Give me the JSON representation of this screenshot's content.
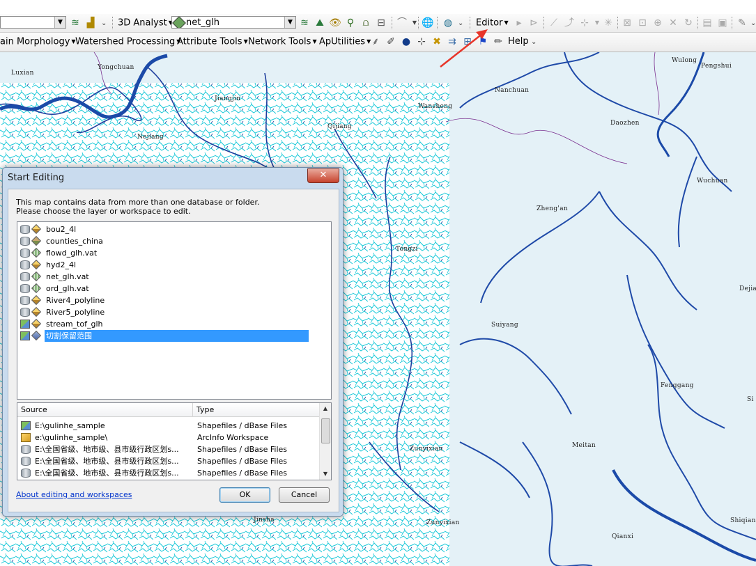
{
  "toolbar1": {
    "analyst_label": "3D Analyst",
    "layer_combo_value": "net_glh",
    "editor_label": "Editor"
  },
  "toolbar2": {
    "menus": [
      "ain Morphology",
      "Watershed Processing",
      "Attribute Tools",
      "Network Tools",
      "ApUtilities"
    ],
    "help_label": "Help"
  },
  "map": {
    "places": [
      "Luxian",
      "Yongchuan",
      "Jiangjin",
      "Nejiang",
      "Qijiang",
      "Wansheng",
      "Nanchuan",
      "Daozhen",
      "Wulong",
      "Pengshui",
      "Wuchuan",
      "Zheng'an",
      "Tongzi",
      "Dejia",
      "Suiyang",
      "Fenggang",
      "Si",
      "Zunyixian",
      "Meitan",
      "Jinsha",
      "Zunyixian",
      "Qianxi",
      "Shiqian"
    ]
  },
  "dialog": {
    "title": "Start Editing",
    "close_glyph": "✕",
    "message_line1": "This map contains data from more than one database or folder.",
    "message_line2": "Please choose the layer or workspace to edit.",
    "layers": [
      {
        "name": "bou2_4l"
      },
      {
        "name": "counties_china"
      },
      {
        "name": "flowd_glh.vat"
      },
      {
        "name": "hyd2_4l"
      },
      {
        "name": "net_glh.vat"
      },
      {
        "name": "ord_glh.vat"
      },
      {
        "name": "River4_polyline"
      },
      {
        "name": "River5_polyline"
      },
      {
        "name": "stream_tof_glh"
      },
      {
        "name": "切割保留范围",
        "selected": true
      }
    ],
    "table_headers": {
      "source": "Source",
      "type": "Type"
    },
    "sources": [
      {
        "source": "E:\\gulinhe_sample",
        "type": "Shapefiles / dBase Files"
      },
      {
        "source": "e:\\gulinhe_sample\\",
        "type": "ArcInfo Workspace"
      },
      {
        "source": "E:\\全国省级、地市级、县市级行政区划s...",
        "type": "Shapefiles / dBase Files"
      },
      {
        "source": "E:\\全国省级、地市级、县市级行政区划s...",
        "type": "Shapefiles / dBase Files"
      },
      {
        "source": "E:\\全国省级、地市级、县市级行政区划s...",
        "type": "Shapefiles / dBase Files"
      }
    ],
    "about_link": "About editing and workspaces",
    "ok_label": "OK",
    "cancel_label": "Cancel"
  },
  "colors": {
    "annotation_arrow": "#e8352a",
    "selection": "#3399ff",
    "river": "#1f4aa8",
    "stream": "#16c8d8"
  }
}
